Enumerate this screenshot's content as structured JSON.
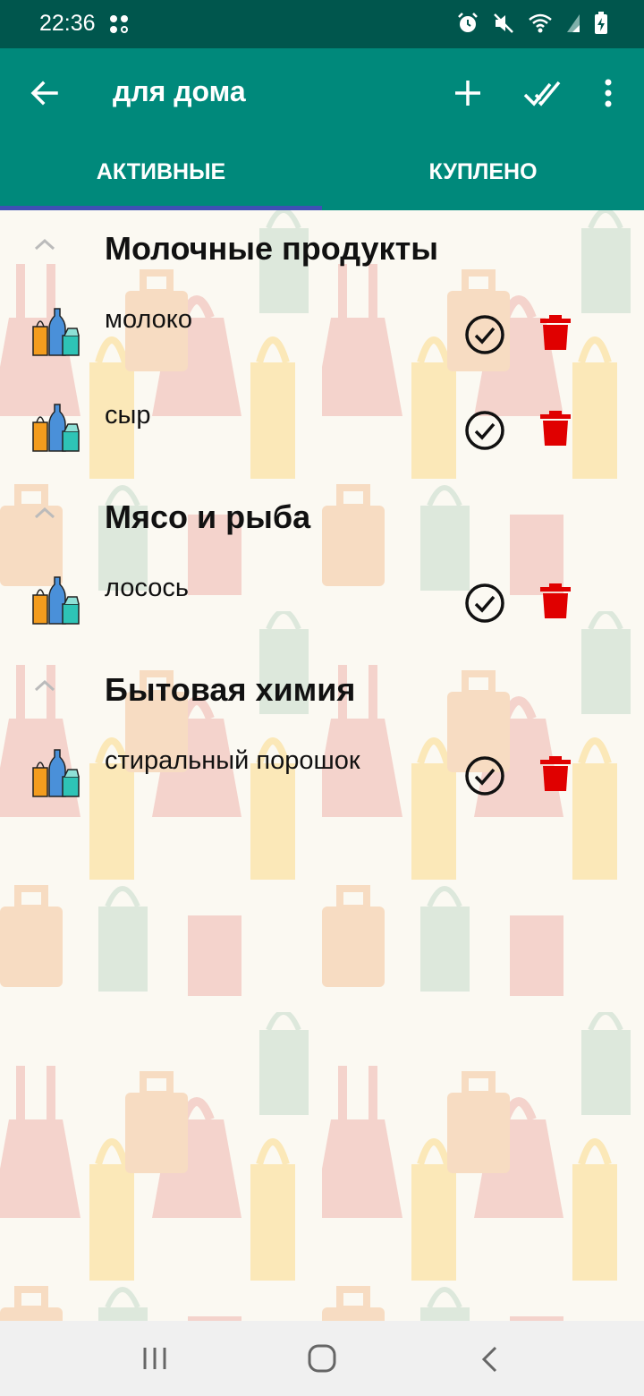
{
  "status_bar": {
    "time": "22:36",
    "left_icon": "share-dots-icon",
    "icons": [
      "alarm-icon",
      "mute-icon",
      "wifi-icon",
      "signal-icon",
      "battery-charging-icon"
    ]
  },
  "app_bar": {
    "title": "для дома",
    "back_icon": "arrow-back-icon",
    "add_icon": "plus-icon",
    "check_all_icon": "double-check-icon",
    "more_icon": "more-vert-icon",
    "color": "#00897b"
  },
  "tabs": [
    {
      "label": "АКТИВНЫЕ",
      "selected": true
    },
    {
      "label": "КУПЛЕНО",
      "selected": false
    }
  ],
  "groups": [
    {
      "title": "Молочные продукты",
      "items": [
        {
          "name": "молоко"
        },
        {
          "name": "сыр"
        }
      ]
    },
    {
      "title": "Мясо и рыба",
      "items": [
        {
          "name": "лосось"
        }
      ]
    },
    {
      "title": "Бытовая химия",
      "items": [
        {
          "name": "стиральный порошок"
        }
      ]
    }
  ],
  "colors": {
    "status_bar": "#00564d",
    "accent_indicator": "#3f51b5",
    "delete": "#e00000"
  },
  "nav_bar": {
    "icons": [
      "recents-icon",
      "home-icon",
      "back-icon"
    ]
  }
}
